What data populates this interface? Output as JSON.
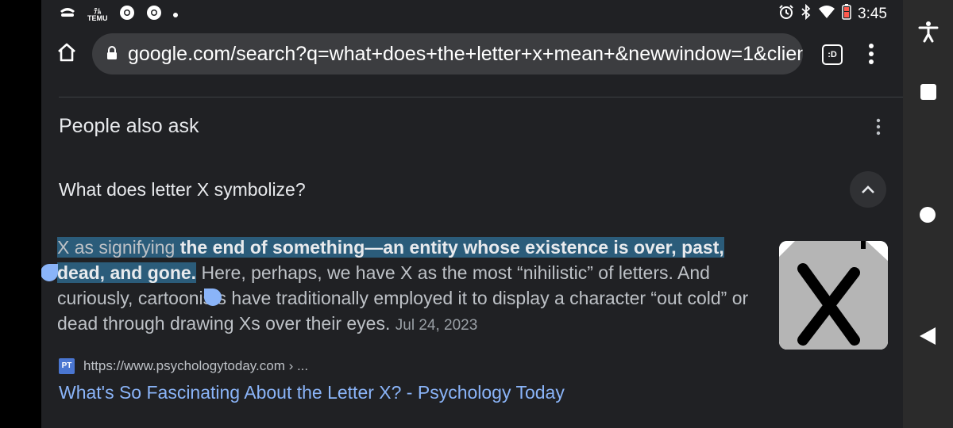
{
  "status_bar": {
    "temu_top": "ﾃﾑ",
    "temu_label": "TEMU",
    "time": "3:45",
    "icons": [
      "app-icon",
      "temu-icon",
      "chrome-icon",
      "chrome-icon",
      "notification-dot",
      "alarm-icon",
      "bluetooth-icon",
      "wifi-icon",
      "battery-icon"
    ]
  },
  "browser": {
    "url": "google.com/search?q=what+does+the+letter+x+mean+&newwindow=1&client=",
    "tab_label": ":D"
  },
  "people_also_ask": {
    "title": "People also ask",
    "question": "What does letter X symbolize?",
    "answer": {
      "highlight_plain": "X as signifying ",
      "highlight_bold": "the end of something—an entity whose existence is over, past, dead, and gone.",
      "rest": " Here, perhaps, we have X as the most “nihilistic” of letters. And curiously, cartoonists have traditionally employed it to display a character “out cold” or dead through drawing Xs over their eyes.",
      "date": "Jul 24, 2023"
    },
    "source": {
      "favicon": "PT",
      "url": "https://www.psychologytoday.com › ...",
      "title": "What's So Fascinating About the Letter X? - Psychology Today"
    }
  },
  "colors": {
    "background": "#202124",
    "link": "#8ab4f8",
    "highlight": "#2b5c7a",
    "text": "#bdc1c6"
  }
}
